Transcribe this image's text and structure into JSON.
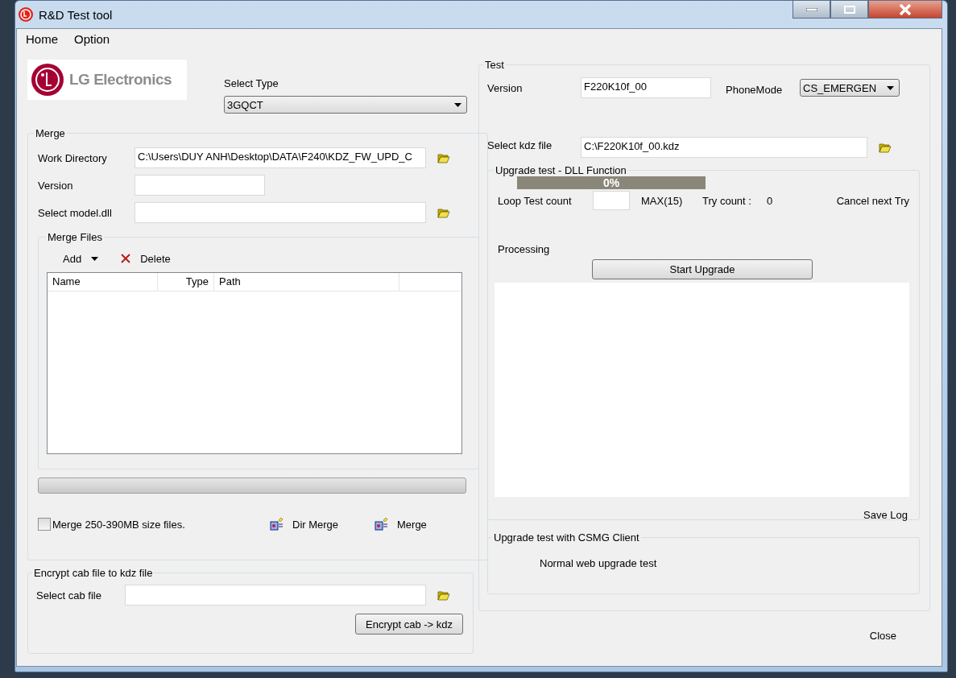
{
  "window": {
    "title": "R&D Test tool"
  },
  "menu": [
    "Home",
    "Option"
  ],
  "logo": {
    "text": "LG Electronics"
  },
  "select_type": {
    "label": "Select Type",
    "value": "3GQCT"
  },
  "merge": {
    "title": "Merge",
    "fields": [
      {
        "label": "Work Directory",
        "value": "C:\\Users\\DUY ANH\\Desktop\\DATA\\F240\\KDZ_FW_UPD_C",
        "wide": true,
        "browse": true
      },
      {
        "label": "Version",
        "wide": false,
        "browse": false
      },
      {
        "label": "Select model.dll",
        "wide": true,
        "browse": true
      }
    ],
    "files": {
      "title": "Merge Files",
      "add": "Add",
      "delete": "Delete",
      "columns": [
        "Name",
        "Type",
        "Path"
      ]
    },
    "progress": {
      "level": 0
    },
    "checkbox": {
      "label": "Merge 250-390MB size files.",
      "checked": false
    },
    "buttons": [
      "Dir Merge",
      "Merge"
    ]
  },
  "encrypt": {
    "title": "Encrypt cab file to kdz file",
    "label": "Select cab file",
    "button": "Encrypt cab -> kdz"
  },
  "test": {
    "title": "Test",
    "version_label": "Version",
    "version": "F220K10f_00",
    "phone_mode_label": "PhoneMode",
    "phone_mode": "CS_EMERGEN",
    "kdz_label": "Select kdz file",
    "kdz": "C:\\F220K10f_00.kdz",
    "dll": {
      "title": "Upgrade test - DLL Function",
      "progress": {
        "level": 0,
        "text": "0%"
      },
      "loop_label": "Loop Test count",
      "max": "MAX(15)",
      "try_label": "Try count :",
      "try_count": "0",
      "cancel": "Cancel next Try",
      "processing": "Processing",
      "start": "Start Upgrade",
      "save_log": "Save Log"
    },
    "csmg": {
      "title": "Upgrade test with CSMG Client",
      "button": "Normal web upgrade test"
    }
  },
  "close": "Close"
}
